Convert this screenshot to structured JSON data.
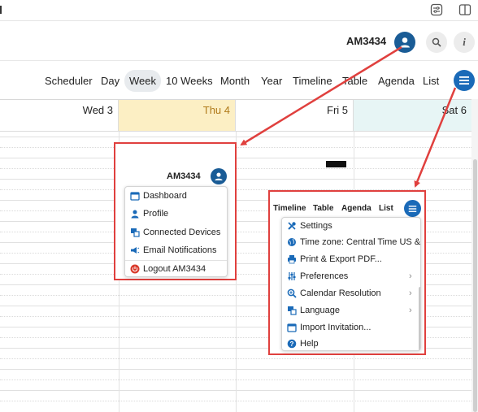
{
  "window": {
    "icons": [
      "sliders-icon",
      "sidebar-toggle-icon"
    ]
  },
  "header": {
    "user_name": "AM3434",
    "icons": [
      "user-avatar-icon",
      "search-icon",
      "info-icon"
    ],
    "accent_color": "#1a5c96"
  },
  "views": {
    "tabs": [
      "Scheduler",
      "Day",
      "Week",
      "10 Weeks",
      "Month",
      "Year",
      "Timeline",
      "Table",
      "Agenda",
      "List"
    ],
    "active": "Week"
  },
  "calendar": {
    "days": [
      {
        "label": "Wed 3",
        "color": "#333333",
        "bg": "#ffffff"
      },
      {
        "label": "Thu 4",
        "color": "#b07a1a",
        "bg": "#fcefc4"
      },
      {
        "label": "Fri 5",
        "color": "#333333",
        "bg": "#ffffff"
      },
      {
        "label": "Sat 6",
        "color": "#333333",
        "bg": "#e7f5f5"
      }
    ]
  },
  "user_menu": {
    "user_name": "AM3434",
    "items": [
      {
        "label": "Dashboard",
        "icon": "calendar-icon"
      },
      {
        "label": "Profile",
        "icon": "person-icon"
      },
      {
        "label": "Connected Devices",
        "icon": "devices-icon"
      },
      {
        "label": "Email Notifications",
        "icon": "megaphone-icon"
      },
      {
        "label": "Logout AM3434",
        "icon": "power-icon"
      }
    ],
    "callout_color": "#e0403e"
  },
  "settings_menu": {
    "tabs": [
      "Timeline",
      "Table",
      "Agenda",
      "List"
    ],
    "items": [
      {
        "label": "Settings",
        "icon": "tools-icon",
        "submenu": false
      },
      {
        "label": "Time zone: Central Time US & Ca",
        "icon": "globe-icon",
        "submenu": false
      },
      {
        "label": "Print & Export PDF...",
        "icon": "printer-icon",
        "submenu": false
      },
      {
        "label": "Preferences",
        "icon": "sliders-icon",
        "submenu": true
      },
      {
        "label": "Calendar Resolution",
        "icon": "zoom-icon",
        "submenu": true
      },
      {
        "label": "Language",
        "icon": "language-icon",
        "submenu": true
      },
      {
        "label": "Import Invitation...",
        "icon": "calendar-import-icon",
        "submenu": false
      },
      {
        "label": "Help",
        "icon": "help-icon",
        "submenu": false
      }
    ]
  }
}
